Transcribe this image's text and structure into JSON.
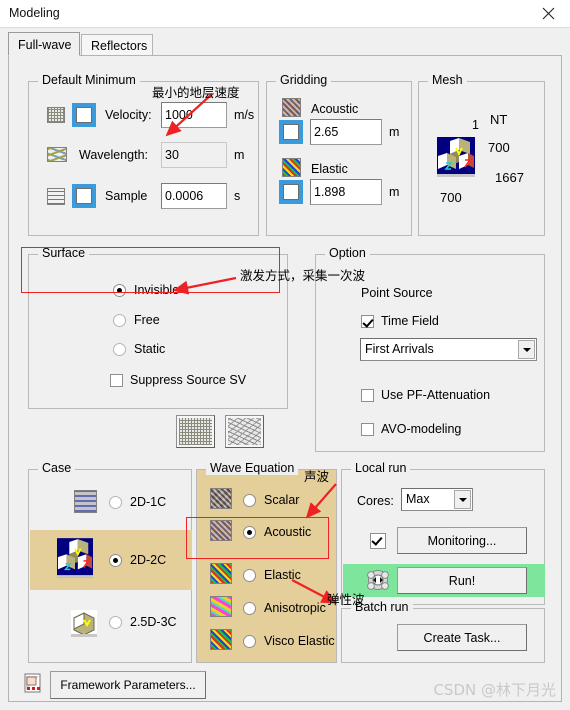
{
  "window": {
    "title": "Modeling",
    "close_label": "close-icon"
  },
  "tabs": [
    {
      "label": "Full-wave",
      "active": true
    },
    {
      "label": "Reflectors",
      "active": false
    }
  ],
  "default_minimum": {
    "legend": "Default Minimum",
    "rows": [
      {
        "label": "Velocity:",
        "value": "1000",
        "unit": "m/s",
        "checked": false,
        "icon": "chart-grid-icon"
      },
      {
        "label": "Wavelength:",
        "value": "30",
        "unit": "m",
        "checked": null,
        "icon": "wave-curve-icon"
      },
      {
        "label": "Sample",
        "value": "0.0006",
        "unit": "s",
        "checked": false,
        "icon": "lines-icon"
      }
    ]
  },
  "gridding": {
    "legend": "Gridding",
    "rows": [
      {
        "label": "Acoustic",
        "value": "2.65",
        "unit": "m",
        "checked": false,
        "icon": "acoustic-texture-icon"
      },
      {
        "label": "Elastic",
        "value": "1.898",
        "unit": "m",
        "checked": false,
        "icon": "elastic-texture-icon"
      }
    ]
  },
  "mesh": {
    "legend": "Mesh",
    "icon": "cube-axes-icon",
    "label_nt": "NT",
    "value_one": "1",
    "value_nt": "700",
    "value_depth": "1667",
    "value_width": "700"
  },
  "surface": {
    "legend": "Surface",
    "options": [
      {
        "label": "Invisible",
        "selected": true
      },
      {
        "label": "Free",
        "selected": false
      },
      {
        "label": "Static",
        "selected": false
      }
    ],
    "suppress": {
      "label": "Suppress Source SV",
      "checked": false
    }
  },
  "option": {
    "legend": "Option",
    "point_source_label": "Point Source",
    "time_field": {
      "label": "Time Field",
      "checked": true
    },
    "arrivals_select": {
      "value": "First Arrivals"
    },
    "use_pf_attenuation": {
      "label": "Use PF-Attenuation",
      "checked": false
    },
    "avo_modeling": {
      "label": "AVO-modeling",
      "checked": false
    }
  },
  "preview_buttons": [
    {
      "name": "mesh-preview-1",
      "icon": "contour-grid-icon"
    },
    {
      "name": "mesh-preview-2",
      "icon": "vector-field-icon"
    }
  ],
  "case": {
    "legend": "Case",
    "options": [
      {
        "label": "2D-1C",
        "selected": false,
        "icon": "wave-slab-icon"
      },
      {
        "label": "2D-2C",
        "selected": true,
        "icon": "cube-axes-icon"
      },
      {
        "label": "2.5D-3C",
        "selected": false,
        "icon": "cube-corner-icon"
      }
    ]
  },
  "wave_equation": {
    "legend": "Wave Equation",
    "options": [
      {
        "label": "Scalar",
        "selected": false,
        "icon": "scalar-texture-icon"
      },
      {
        "label": "Acoustic",
        "selected": true,
        "icon": "acoustic-texture-icon"
      },
      {
        "label": "Elastic",
        "selected": false,
        "icon": "elastic-texture-icon"
      },
      {
        "label": "Anisotropic",
        "selected": false,
        "icon": "anisotropic-texture-icon"
      },
      {
        "label": "Visco Elastic",
        "selected": false,
        "icon": "visco-texture-icon"
      }
    ]
  },
  "local_run": {
    "legend": "Local run",
    "cores_label": "Cores:",
    "cores_value": "Max",
    "monitoring": {
      "label": "Monitoring...",
      "checked": true
    },
    "run": {
      "label": "Run!",
      "icon": "run-gear-icon"
    }
  },
  "batch_run": {
    "legend": "Batch run",
    "create_task_label": "Create Task..."
  },
  "footer": {
    "framework_label": "Framework Parameters...",
    "framework_icon": "framework-doc-icon"
  },
  "annotations": [
    {
      "text": "最小的地层速度",
      "name": "annotation-min-velocity"
    },
    {
      "text": "激发方式，采集一次波",
      "name": "annotation-source-mode"
    },
    {
      "text": "声波",
      "name": "annotation-acoustic-wave"
    },
    {
      "text": "弹性波",
      "name": "annotation-elastic-wave"
    }
  ],
  "watermark": {
    "text": "CSDN @林下月光"
  },
  "colors": {
    "highlight_tan": "#e4cf9a",
    "highlight_green": "#7ee69c",
    "annotation_red": "#ee2222",
    "checkbox_blue": "#3a9bdc"
  }
}
